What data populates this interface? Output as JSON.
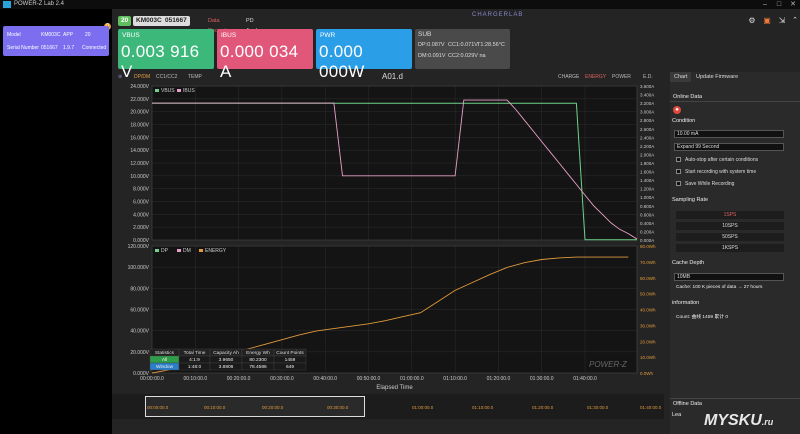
{
  "window": {
    "title": "POWER-Z Lab 2.4"
  },
  "device": {
    "model_label": "Model",
    "model": "KM003C",
    "app_label": "APP",
    "app_ver": "20",
    "sn_label": "Serial Number",
    "sn": "051667",
    "fw": "1.9.7",
    "status": "Connected",
    "badge": "0"
  },
  "header": {
    "badge": "20",
    "model": "KM003C",
    "sn": "051667",
    "recorder": "Data Recorder",
    "analyzer": "PD Analyzer",
    "brand": "CHARGERLAB"
  },
  "meters": {
    "vbus_label": "VBUS",
    "vbus": "0.003 916 V",
    "ibus_label": "IBUS",
    "ibus": "0.000 034 A",
    "pwr_label": "PWR",
    "pwr": "0.000 000W",
    "sub_label": "SUB",
    "dp": "DP:0.087V",
    "cc1": "CC1:0.071V",
    "temp": "T1:28.56°C",
    "dm": "DM:0.091V",
    "cc2": "CC2:0.029V na"
  },
  "tabs": {
    "dpdm": "DP/DM",
    "cc": "CC1/CC2",
    "temp": "TEMP",
    "title": "A01.d",
    "charge": "CHARGE",
    "energy": "ENERGY",
    "power": "POWER",
    "ed": "E.D."
  },
  "chart_data": [
    {
      "type": "line",
      "title": "A01.d",
      "xlabel": "",
      "ylabel": "",
      "legend": [
        "VBUS",
        "IBUS"
      ],
      "y_left_ticks": [
        "0.000V",
        "2.000V",
        "4.000V",
        "6.000V",
        "8.000V",
        "10.000V",
        "12.000V",
        "14.000V",
        "16.000V",
        "18.000V",
        "20.000V",
        "22.000V",
        "24.000V"
      ],
      "y_right_ticks": [
        "0.000A",
        "0.200A",
        "0.400A",
        "0.600A",
        "0.800A",
        "1.000A",
        "1.200A",
        "1.400A",
        "1.600A",
        "1.800A",
        "2.000A",
        "2.200A",
        "2.400A",
        "2.600A",
        "2.800A",
        "3.000A",
        "3.200A",
        "3.400A",
        "3.600A"
      ],
      "x_min": [
        0,
        2,
        4,
        6,
        8,
        10,
        12,
        13,
        14,
        16,
        17,
        18,
        20,
        22,
        24,
        26,
        28,
        30,
        32,
        34,
        35,
        36,
        38,
        40,
        42,
        44,
        46,
        48,
        50,
        52,
        54,
        56,
        58,
        60,
        62,
        64,
        66,
        68,
        70,
        72,
        74,
        76,
        78,
        80,
        82,
        84,
        86,
        88,
        90,
        92,
        94,
        96,
        98,
        100,
        102,
        104,
        106,
        108,
        110,
        112
      ],
      "series": [
        {
          "name": "VBUS",
          "color": "#6fd18a",
          "values": [
            21.3,
            21.3,
            21.3,
            21.3,
            21.3,
            21.3,
            21.3,
            21.3,
            21.3,
            21.3,
            21.3,
            21.3,
            21.3,
            21.3,
            21.3,
            21.3,
            21.3,
            21.3,
            21.3,
            21.3,
            21.3,
            21.3,
            21.3,
            21.3,
            21.3,
            21.3,
            21.3,
            21.3,
            21.3,
            21.3,
            21.3,
            21.3,
            21.3,
            21.3,
            21.3,
            21.3,
            21.3,
            21.3,
            21.3,
            21.3,
            21.3,
            21.3,
            21.3,
            21.3,
            21.3,
            21.3,
            21.3,
            21.3,
            21.3,
            21.3,
            21.3,
            21.3,
            21.3,
            0.05,
            0.05,
            0.05,
            0.05,
            0.05,
            0.05,
            0.05
          ]
        },
        {
          "name": "IBUS",
          "color": "#e8a0c8",
          "values": [
            3.2,
            3.2,
            3.2,
            3.2,
            3.2,
            3.2,
            3.2,
            3.2,
            3.2,
            3.2,
            3.2,
            3.2,
            3.2,
            3.2,
            3.2,
            3.2,
            3.2,
            3.2,
            3.2,
            3.2,
            3.2,
            3.2,
            3.2,
            3.2,
            3.2,
            1.5,
            1.5,
            1.5,
            1.5,
            1.5,
            1.5,
            1.5,
            1.5,
            1.5,
            1.5,
            1.5,
            1.5,
            1.5,
            1.5,
            3.27,
            3.27,
            3.27,
            3.27,
            3.27,
            3.27,
            3.05,
            2.8,
            2.55,
            2.3,
            2.05,
            1.8,
            1.55,
            1.3,
            1.05,
            0.8,
            0.6,
            0.4,
            0.25,
            0.15,
            0.02
          ]
        }
      ]
    },
    {
      "type": "line",
      "xlabel": "Elapsed Time",
      "ylabel": "",
      "legend": [
        "DP",
        "DM",
        "ENERGY"
      ],
      "x_ticks": [
        "00:00:00.0",
        "00:10:00.0",
        "00:20:00.0",
        "00:30:00.0",
        "00:40:00.0",
        "00:50:00.0",
        "01:00:00.0",
        "01:10:00.0",
        "01:20:00.0",
        "01:30:00.0",
        "01:40:00.0"
      ],
      "y_left_ticks": [
        "0.000V",
        "20.000V",
        "40.000V",
        "60.000V",
        "80.000V",
        "100.000V",
        "120.000V"
      ],
      "y_right_ticks": [
        "0.0Wh",
        "10.0Wh",
        "20.0Wh",
        "30.0Wh",
        "40.0Wh",
        "50.0Wh",
        "60.0Wh",
        "70.0Wh",
        "80.0Wh"
      ],
      "x_min": [
        0,
        6,
        10,
        14,
        18,
        22,
        26,
        30,
        34,
        38,
        42,
        46,
        50,
        54,
        58,
        62,
        66,
        70,
        74,
        78,
        82,
        86,
        90,
        94,
        98,
        102,
        106,
        110
      ],
      "series": [
        {
          "name": "ENERGY",
          "color": "#e09a3c",
          "values": [
            0,
            3,
            6,
            9,
            12,
            15,
            18,
            21,
            24,
            26.5,
            28,
            29.5,
            31,
            33,
            35.5,
            38,
            45,
            52,
            57,
            62,
            66.5,
            69.5,
            71.5,
            72.5,
            73,
            73,
            73,
            73
          ]
        }
      ]
    }
  ],
  "stats": {
    "headers": [
      "Statistics",
      "Total Time",
      "Capacity Ah",
      "Energy Wh",
      "Count Points"
    ],
    "rows": [
      [
        "All",
        "4:1:9",
        "3.9650",
        "80.2300",
        "1459"
      ],
      [
        "Window",
        "1:48:0",
        "3.8806",
        "78.4586",
        "649"
      ]
    ]
  },
  "power_logo": "POWER-Z",
  "scroll_ticks": [
    "00:00:00.0",
    "00:10:00.0",
    "00:20:00.0",
    "00:30:00.0",
    "01:00:00.0",
    "01:10:00.0",
    "01:20:00.0",
    "01:30:00.0",
    "01:40:00.0"
  ],
  "right": {
    "tab_chart": "Chart",
    "tab_update": "Update Firmware",
    "online": "Online Data",
    "condition": "Condition",
    "cond_value": "10.00 mA",
    "expand": "Expand 99 Second",
    "chk1": "Auto-stop after certain conditions",
    "chk2": "Start recording with system time",
    "chk3": "Save While Recording",
    "sampling": "Sampling Rate",
    "rates": [
      "1SPS",
      "10SPS",
      "50SPS",
      "1KSPS"
    ],
    "cache": "Cache Depth",
    "cache_value": "10MB",
    "cache_note": "Cache: 100 K pieces of data → 27 hours",
    "information": "information",
    "info_text": "Count: 曲线 1459 累计 0",
    "offline": "Offline Data",
    "lea": "Lea"
  },
  "watermark": "MYSKU",
  "watermark2": ".ru"
}
